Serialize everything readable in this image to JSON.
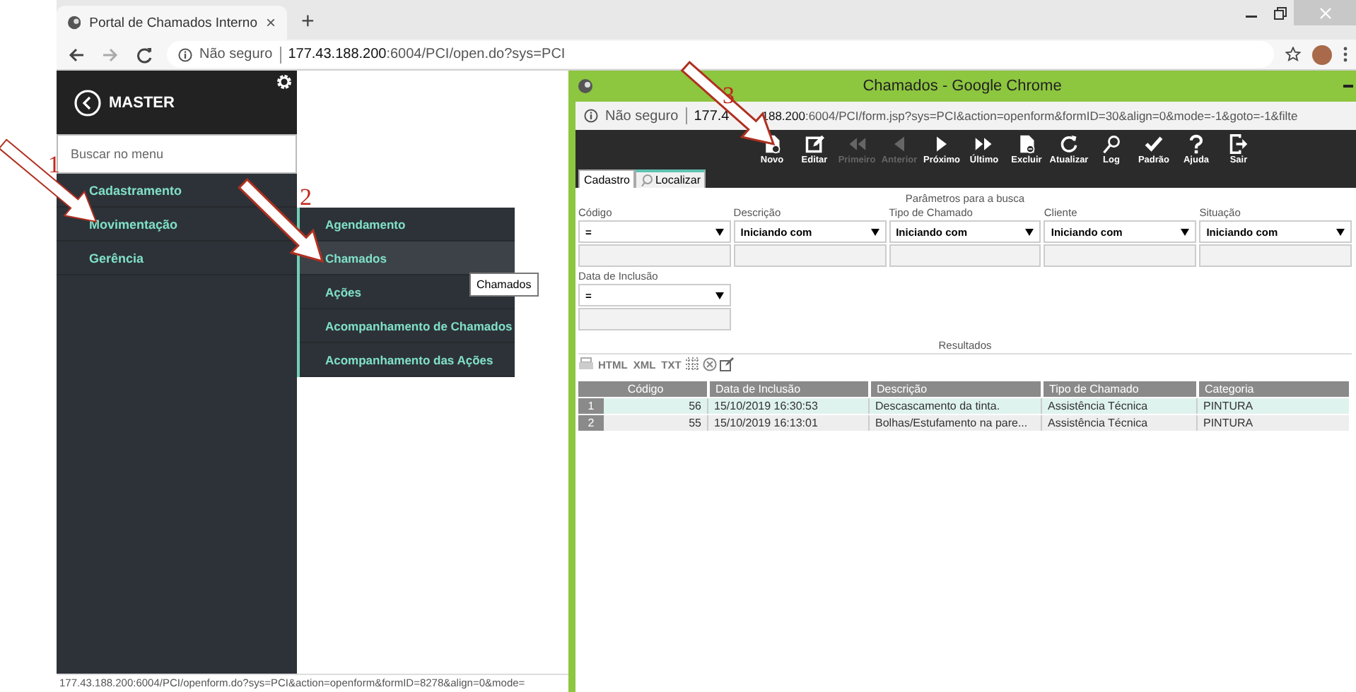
{
  "browser": {
    "tab_title": "Portal de Chamados Interno",
    "tab_close": "×",
    "new_tab": "+",
    "security": "Não seguro",
    "url_host": "177.43.188.200",
    "url_path": ":6004/PCI/open.do?sys=PCI",
    "status_url": "177.43.188.200:6004/PCI/openform.do?sys=PCI&action=openform&formID=8278&align=0&mode="
  },
  "sidebar": {
    "title": "MASTER",
    "search_placeholder": "Buscar no menu",
    "items": [
      {
        "label": "Cadastramento"
      },
      {
        "label": "Movimentação"
      },
      {
        "label": "Gerência"
      }
    ]
  },
  "submenu": {
    "items": [
      {
        "label": "Agendamento",
        "selected": false
      },
      {
        "label": "Chamados",
        "selected": true
      },
      {
        "label": "Ações",
        "selected": false
      },
      {
        "label": "Acompanhamento de Chamados",
        "selected": false
      },
      {
        "label": "Acompanhamento das Ações",
        "selected": false
      }
    ]
  },
  "tooltip": "Chamados",
  "annotations": [
    {
      "number": "1"
    },
    {
      "number": "2"
    },
    {
      "number": "3"
    }
  ],
  "popup": {
    "title": "Chamados - Google Chrome",
    "security": "Não seguro",
    "url_host_start": "177.4",
    "url_host_end": "188.200",
    "url_path": ":6004/PCI/form.jsp?sys=PCI&action=openform&formID=30&align=0&mode=-1&goto=-1&filte",
    "toolbar": [
      {
        "label": "Novo",
        "kind": "new",
        "disabled": false
      },
      {
        "label": "Editar",
        "kind": "edit",
        "disabled": false
      },
      {
        "label": "Primeiro",
        "kind": "first",
        "disabled": true
      },
      {
        "label": "Anterior",
        "kind": "prev",
        "disabled": true
      },
      {
        "label": "Próximo",
        "kind": "next",
        "disabled": false
      },
      {
        "label": "Último",
        "kind": "last",
        "disabled": false
      },
      {
        "label": "Excluir",
        "kind": "delete",
        "disabled": false
      },
      {
        "label": "Atualizar",
        "kind": "refresh",
        "disabled": false
      },
      {
        "label": "Log",
        "kind": "log",
        "disabled": false
      },
      {
        "label": "Padrão",
        "kind": "check",
        "disabled": false
      },
      {
        "label": "Ajuda",
        "kind": "help",
        "disabled": false
      },
      {
        "label": "Sair",
        "kind": "exit",
        "disabled": false
      }
    ],
    "tabs": [
      {
        "label": "Cadastro",
        "selected": false
      },
      {
        "label": "Localizar",
        "selected": true
      }
    ],
    "params_title": "Parâmetros para a busca",
    "filters": [
      {
        "label": "Código",
        "operator": "="
      },
      {
        "label": "Descrição",
        "operator": "Iniciando com"
      },
      {
        "label": "Tipo de Chamado",
        "operator": "Iniciando com"
      },
      {
        "label": "Cliente",
        "operator": "Iniciando com"
      },
      {
        "label": "Situação",
        "operator": "Iniciando com"
      },
      {
        "label": "Data de Inclusão",
        "operator": "="
      }
    ],
    "results_title": "Resultados",
    "export": [
      "HTML",
      "XML",
      "TXT"
    ],
    "table": {
      "columns": [
        "Código",
        "Data de Inclusão",
        "Descrição",
        "Tipo de Chamado",
        "Categoria"
      ],
      "rows": [
        {
          "index": "1",
          "selected": true,
          "cells": [
            "56",
            "15/10/2019 16:30:53",
            "Descascamento da tinta.",
            "Assistência Técnica",
            "PINTURA"
          ]
        },
        {
          "index": "2",
          "selected": false,
          "cells": [
            "55",
            "15/10/2019 16:13:01",
            "Bolhas/Estufamento na pare...",
            "Assistência Técnica",
            "PINTURA"
          ]
        }
      ]
    }
  }
}
